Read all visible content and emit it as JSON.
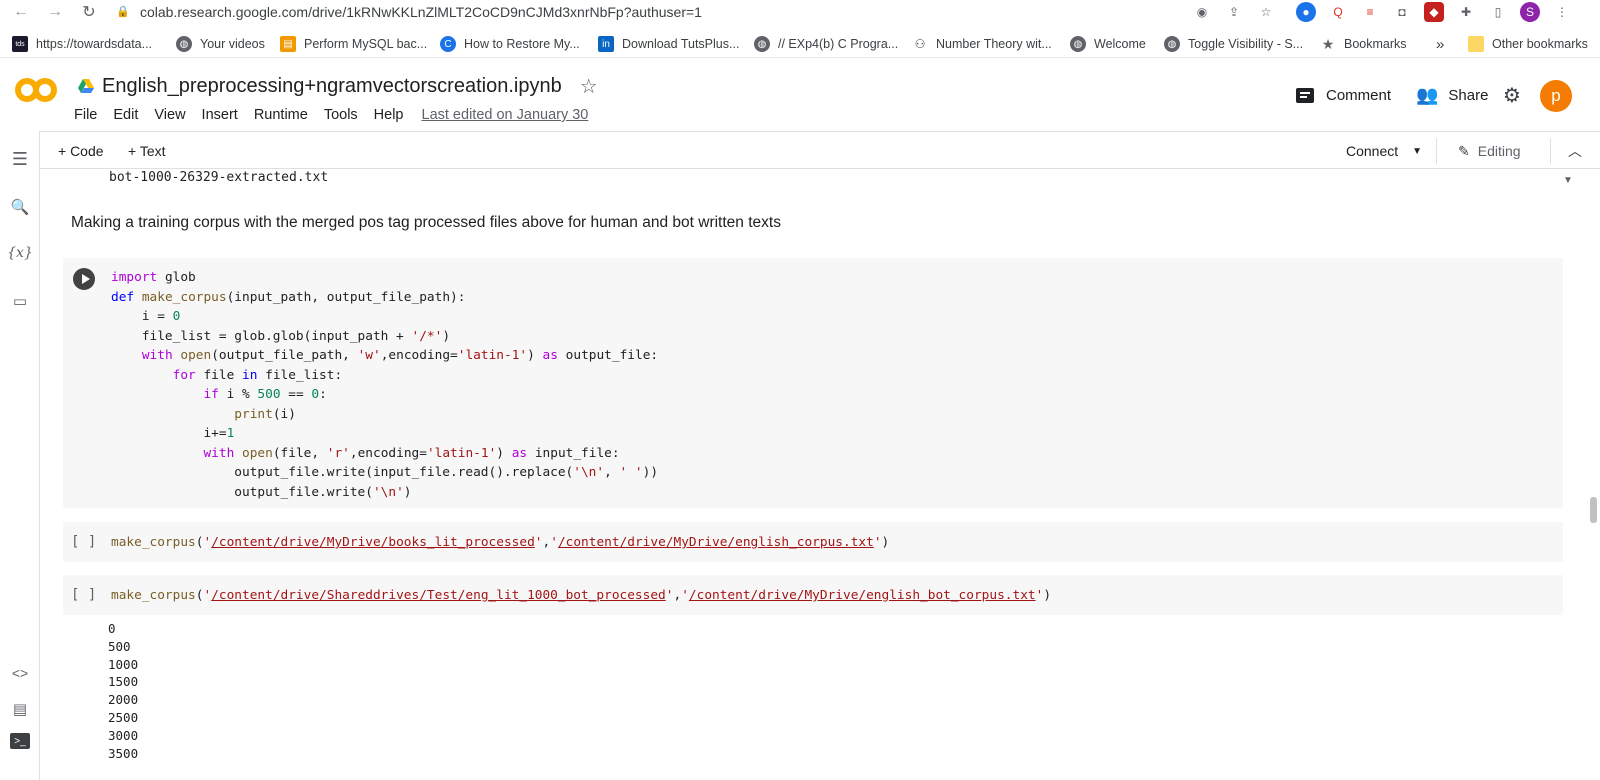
{
  "browser": {
    "url": "colab.research.google.com/drive/1kRNwKKLnZlMLT2CoCD9nCJMd3xnrNbFp?authuser=1",
    "profile_initial": "S",
    "bookmarks": [
      {
        "label": "https://towardsdata...",
        "icon": "tds-icon"
      },
      {
        "label": "Your videos",
        "icon": "globe-icon"
      },
      {
        "label": "Perform MySQL bac...",
        "icon": "page-icon"
      },
      {
        "label": "How to Restore My...",
        "icon": "c-icon"
      },
      {
        "label": "Download TutsPlus...",
        "icon": "linkedin-icon"
      },
      {
        "label": "// EXp4(b) C Progra...",
        "icon": "globe-icon"
      },
      {
        "label": "Number Theory wit...",
        "icon": "bike-icon"
      },
      {
        "label": "Welcome",
        "icon": "globe-icon"
      },
      {
        "label": "Toggle Visibility - S...",
        "icon": "globe-icon"
      },
      {
        "label": "Bookmarks",
        "icon": "star-icon"
      }
    ],
    "overflow": "»",
    "other_bookmarks": "Other bookmarks"
  },
  "colab": {
    "logo": "CO",
    "notebook_title": "English_preprocessing+ngramvectorscreation.ipynb",
    "menu": [
      "File",
      "Edit",
      "View",
      "Insert",
      "Runtime",
      "Tools",
      "Help"
    ],
    "last_edited": "Last edited on January 30",
    "comment_label": "Comment",
    "share_label": "Share",
    "avatar_initial": "p",
    "add_code": "+ Code",
    "add_text": "+ Text",
    "connect_label": "Connect",
    "editing_label": "Editing"
  },
  "notebook": {
    "prev_output": "bot-1000-26329-extracted.txt",
    "text_cell": "Making a training corpus with the merged pos tag processed files above for human and bot written texts",
    "cell2_exec": "[ ]",
    "cell2_code": "make_corpus('/content/drive/MyDrive/books_lit_processed','/content/drive/MyDrive/english_corpus.txt')",
    "cell3_exec": "[ ]",
    "cell3_code": "make_corpus('/content/drive/Shareddrives/Test/eng_lit_1000_bot_processed','/content/drive/MyDrive/english_bot_corpus.txt')",
    "output_lines": [
      "0",
      "500",
      "1000",
      "1500",
      "2000",
      "2500",
      "3000",
      "3500"
    ]
  },
  "colors": {
    "colab_orange": "#f9ab00",
    "avatar_orange": "#f57c00",
    "keyword_blue": "#0000ff",
    "string_red": "#a31515"
  }
}
